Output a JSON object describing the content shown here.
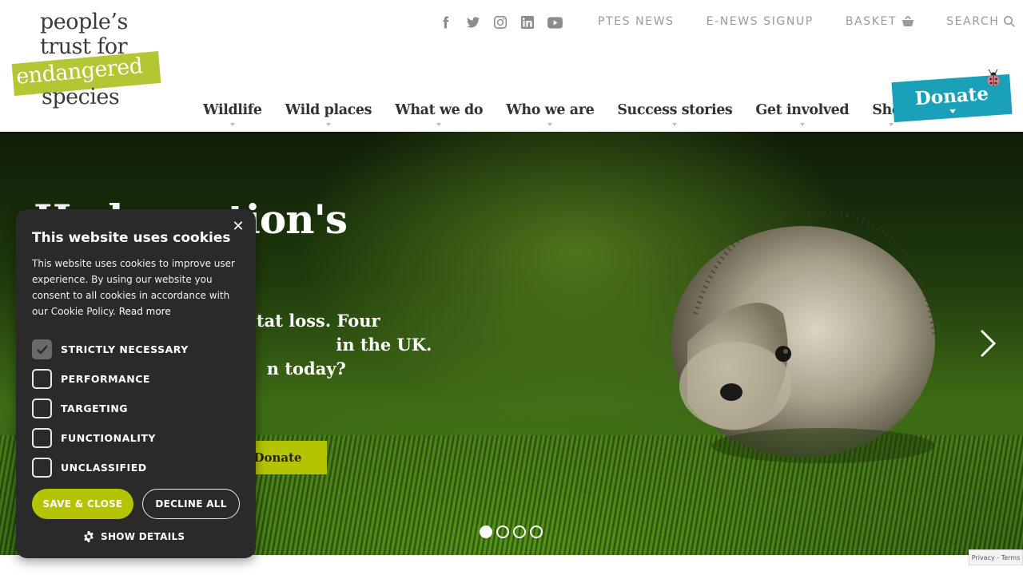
{
  "logo": {
    "line1": "people’s",
    "line2": "trust for",
    "line3": "endangered",
    "line4": "species"
  },
  "social": [
    "facebook-icon",
    "twitter-icon",
    "instagram-icon",
    "linkedin-icon",
    "youtube-icon"
  ],
  "top_links": {
    "news": "PTES NEWS",
    "signup": "E-NEWS SIGNUP",
    "basket": "BASKET",
    "search": "SEARCH"
  },
  "nav": {
    "items": [
      "Wildlife",
      "Wild places",
      "What we do",
      "Who we are",
      "Success stories",
      "Get involved",
      "Shop"
    ]
  },
  "donate_button": "Donate",
  "hero": {
    "heading": "He          he nation's",
    "para": "                          nd habitat loss. Four                           ssified as being                           in the UK. Can you                           n today?",
    "cta": "Donate"
  },
  "slider": {
    "dots": 4,
    "active": 1
  },
  "recaptcha": "Privacy - Terms",
  "cookie": {
    "title": "This website uses cookies",
    "desc": "This website uses cookies to improve user experience. By using our website you consent to all cookies in accordance with our Cookie Policy.",
    "read_more": "Read more",
    "options": [
      {
        "label": "STRICTLY NECESSARY",
        "checked": true
      },
      {
        "label": "PERFORMANCE",
        "checked": false
      },
      {
        "label": "TARGETING",
        "checked": false
      },
      {
        "label": "FUNCTIONALITY",
        "checked": false
      },
      {
        "label": "UNCLASSIFIED",
        "checked": false
      }
    ],
    "save": "SAVE & CLOSE",
    "decline": "DECLINE ALL",
    "details": "SHOW DETAILS"
  },
  "colors": {
    "accent_green": "#b5c400",
    "donate_teal": "#1aa1b9",
    "cookie_bg": "#2a2a2a"
  }
}
